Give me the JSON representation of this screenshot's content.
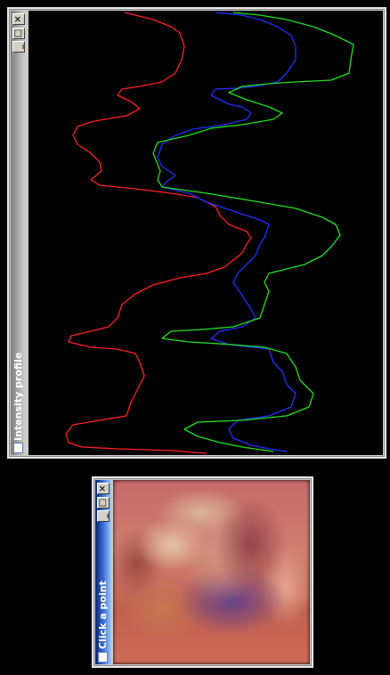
{
  "windows": {
    "profile": {
      "title": "Intensity profile",
      "controls": {
        "close": "✕",
        "maximize": "□",
        "minimize": "_"
      }
    },
    "click": {
      "title": "Click a point",
      "controls": {
        "close": "✕",
        "maximize": "□",
        "minimize": "_"
      }
    }
  },
  "chart_data": {
    "type": "line",
    "series": [
      {
        "color": "#ff2020",
        "values": [
          [
            108,
            2
          ],
          [
            120,
            5
          ],
          [
            140,
            10
          ],
          [
            160,
            18
          ],
          [
            170,
            25
          ],
          [
            175,
            40
          ],
          [
            172,
            55
          ],
          [
            165,
            70
          ],
          [
            150,
            80
          ],
          [
            125,
            85
          ],
          [
            105,
            88
          ],
          [
            100,
            95
          ],
          [
            115,
            102
          ],
          [
            125,
            110
          ],
          [
            110,
            118
          ],
          [
            85,
            122
          ],
          [
            70,
            125
          ],
          [
            55,
            130
          ],
          [
            50,
            140
          ],
          [
            55,
            150
          ],
          [
            70,
            160
          ],
          [
            80,
            170
          ],
          [
            82,
            180
          ],
          [
            70,
            190
          ],
          [
            80,
            196
          ],
          [
            120,
            200
          ],
          [
            160,
            205
          ],
          [
            190,
            210
          ],
          [
            200,
            215
          ],
          [
            210,
            220
          ],
          [
            215,
            230
          ],
          [
            225,
            240
          ],
          [
            245,
            248
          ],
          [
            250,
            255
          ],
          [
            245,
            262
          ],
          [
            240,
            272
          ],
          [
            230,
            280
          ],
          [
            220,
            288
          ],
          [
            200,
            295
          ],
          [
            170,
            300
          ],
          [
            140,
            308
          ],
          [
            120,
            318
          ],
          [
            105,
            330
          ],
          [
            100,
            345
          ],
          [
            90,
            355
          ],
          [
            70,
            360
          ],
          [
            48,
            365
          ],
          [
            45,
            372
          ],
          [
            70,
            378
          ],
          [
            100,
            380
          ],
          [
            120,
            385
          ],
          [
            125,
            395
          ],
          [
            130,
            410
          ],
          [
            125,
            420
          ],
          [
            115,
            440
          ],
          [
            110,
            455
          ],
          [
            80,
            460
          ],
          [
            50,
            465
          ],
          [
            42,
            475
          ],
          [
            45,
            485
          ],
          [
            60,
            490
          ],
          [
            100,
            492
          ],
          [
            160,
            494
          ],
          [
            200,
            497
          ]
        ]
      },
      {
        "color": "#2030ff",
        "values": [
          [
            210,
            2
          ],
          [
            240,
            5
          ],
          [
            260,
            10
          ],
          [
            280,
            18
          ],
          [
            295,
            28
          ],
          [
            300,
            40
          ],
          [
            300,
            55
          ],
          [
            290,
            70
          ],
          [
            280,
            80
          ],
          [
            255,
            85
          ],
          [
            235,
            87
          ],
          [
            210,
            88
          ],
          [
            205,
            95
          ],
          [
            215,
            100
          ],
          [
            225,
            105
          ],
          [
            240,
            108
          ],
          [
            250,
            115
          ],
          [
            245,
            122
          ],
          [
            220,
            128
          ],
          [
            185,
            133
          ],
          [
            165,
            140
          ],
          [
            150,
            150
          ],
          [
            145,
            165
          ],
          [
            150,
            175
          ],
          [
            165,
            185
          ],
          [
            155,
            192
          ],
          [
            150,
            198
          ],
          [
            180,
            205
          ],
          [
            200,
            215
          ],
          [
            230,
            225
          ],
          [
            260,
            235
          ],
          [
            270,
            240
          ],
          [
            265,
            255
          ],
          [
            260,
            262
          ],
          [
            255,
            275
          ],
          [
            245,
            285
          ],
          [
            235,
            295
          ],
          [
            230,
            305
          ],
          [
            240,
            320
          ],
          [
            250,
            335
          ],
          [
            255,
            345
          ],
          [
            240,
            355
          ],
          [
            215,
            360
          ],
          [
            205,
            368
          ],
          [
            225,
            375
          ],
          [
            270,
            380
          ],
          [
            275,
            395
          ],
          [
            285,
            405
          ],
          [
            290,
            420
          ],
          [
            300,
            430
          ],
          [
            295,
            445
          ],
          [
            270,
            455
          ],
          [
            235,
            460
          ],
          [
            225,
            470
          ],
          [
            230,
            480
          ],
          [
            250,
            488
          ],
          [
            270,
            492
          ],
          [
            290,
            495
          ]
        ]
      },
      {
        "color": "#20e020",
        "values": [
          [
            230,
            2
          ],
          [
            260,
            5
          ],
          [
            290,
            10
          ],
          [
            320,
            18
          ],
          [
            345,
            28
          ],
          [
            365,
            38
          ],
          [
            362,
            55
          ],
          [
            360,
            70
          ],
          [
            340,
            78
          ],
          [
            300,
            80
          ],
          [
            270,
            82
          ],
          [
            240,
            85
          ],
          [
            225,
            92
          ],
          [
            245,
            100
          ],
          [
            270,
            108
          ],
          [
            285,
            115
          ],
          [
            275,
            122
          ],
          [
            240,
            128
          ],
          [
            205,
            132
          ],
          [
            180,
            140
          ],
          [
            145,
            148
          ],
          [
            140,
            160
          ],
          [
            148,
            180
          ],
          [
            145,
            190
          ],
          [
            150,
            198
          ],
          [
            200,
            205
          ],
          [
            260,
            215
          ],
          [
            300,
            222
          ],
          [
            330,
            232
          ],
          [
            345,
            240
          ],
          [
            350,
            252
          ],
          [
            340,
            265
          ],
          [
            330,
            275
          ],
          [
            310,
            285
          ],
          [
            290,
            290
          ],
          [
            270,
            295
          ],
          [
            265,
            305
          ],
          [
            270,
            315
          ],
          [
            265,
            330
          ],
          [
            260,
            345
          ],
          [
            230,
            355
          ],
          [
            195,
            358
          ],
          [
            160,
            360
          ],
          [
            150,
            368
          ],
          [
            180,
            372
          ],
          [
            230,
            375
          ],
          [
            265,
            378
          ],
          [
            290,
            385
          ],
          [
            300,
            400
          ],
          [
            305,
            415
          ],
          [
            320,
            430
          ],
          [
            315,
            445
          ],
          [
            290,
            455
          ],
          [
            240,
            460
          ],
          [
            190,
            462
          ],
          [
            175,
            470
          ],
          [
            190,
            478
          ],
          [
            215,
            485
          ],
          [
            240,
            490
          ],
          [
            275,
            495
          ]
        ]
      }
    ]
  }
}
